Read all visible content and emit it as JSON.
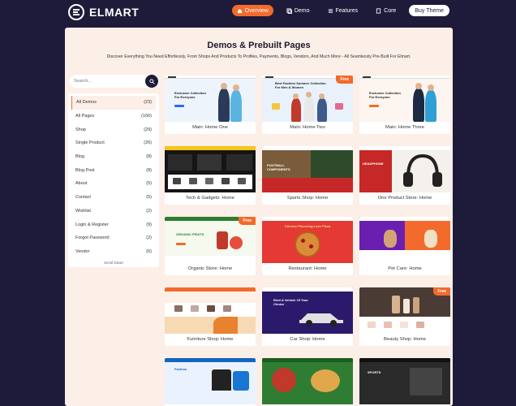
{
  "brand": {
    "name": "ELMART"
  },
  "nav": {
    "overview": "Overview",
    "demo": "Demo",
    "features": "Features",
    "core": "Core",
    "buy": "Buy Theme"
  },
  "page": {
    "title": "Demos & Prebuilt Pages",
    "subtitle": "Discover Everything You Need Effortlessly, From Shops And Products To Profiles, Payments, Blogs, Vendors, And Much More - All Seamlessly Pre-Built For Elmart."
  },
  "search": {
    "placeholder": "Search..."
  },
  "filters": [
    {
      "label": "All Demos",
      "count": "(23)"
    },
    {
      "label": "All Pages",
      "count": "(166)"
    },
    {
      "label": "Shop",
      "count": "(29)"
    },
    {
      "label": "Single Product",
      "count": "(26)"
    },
    {
      "label": "Blog",
      "count": "(8)"
    },
    {
      "label": "Blog Post",
      "count": "(8)"
    },
    {
      "label": "About",
      "count": "(5)"
    },
    {
      "label": "Contact",
      "count": "(5)"
    },
    {
      "label": "Wishlist",
      "count": "(2)"
    },
    {
      "label": "Login & Register",
      "count": "(9)"
    },
    {
      "label": "Forgot Password",
      "count": "(2)"
    },
    {
      "label": "Vendor",
      "count": "(6)"
    }
  ],
  "filters_footer": "Scroll Down",
  "free_badge": "Free",
  "thumb_texts": {
    "one": "Exclusive Collection For Everyone",
    "two": "Best Fashion Summer Collection For Men & Women",
    "three": "Exclusive Collection For Everyone",
    "sports": "FOOTBALL COMPONENTS",
    "onep": "HEADPHONE",
    "organic": "ORGANIC FRUITS",
    "restaurant": "Chinese Flavoring Love Pizza",
    "car": "Rent A Vehicle Of Your Choice",
    "fashion": "Fashion",
    "dark": "SPORTS"
  },
  "demos": [
    {
      "label": "Main: Home One",
      "free": false
    },
    {
      "label": "Main: Home Two",
      "free": true
    },
    {
      "label": "Main: Home Three",
      "free": false
    },
    {
      "label": "Tech & Gadgets: Home",
      "free": false
    },
    {
      "label": "Sports Shop: Home",
      "free": false
    },
    {
      "label": "One Product Store: Home",
      "free": false
    },
    {
      "label": "Organic Store: Home",
      "free": true
    },
    {
      "label": "Restaurant: Home",
      "free": false
    },
    {
      "label": "Pet Care: Home",
      "free": false
    },
    {
      "label": "Furniture Shop: Home",
      "free": false
    },
    {
      "label": "Car Shop: Home",
      "free": false
    },
    {
      "label": "Beauty Shop: Home",
      "free": true
    },
    {
      "label": "",
      "free": false
    },
    {
      "label": "",
      "free": false
    },
    {
      "label": "",
      "free": false
    }
  ],
  "colors": {
    "accent": "#f26b2c",
    "navy": "#1e1b3a",
    "panel": "#fcefe8"
  }
}
